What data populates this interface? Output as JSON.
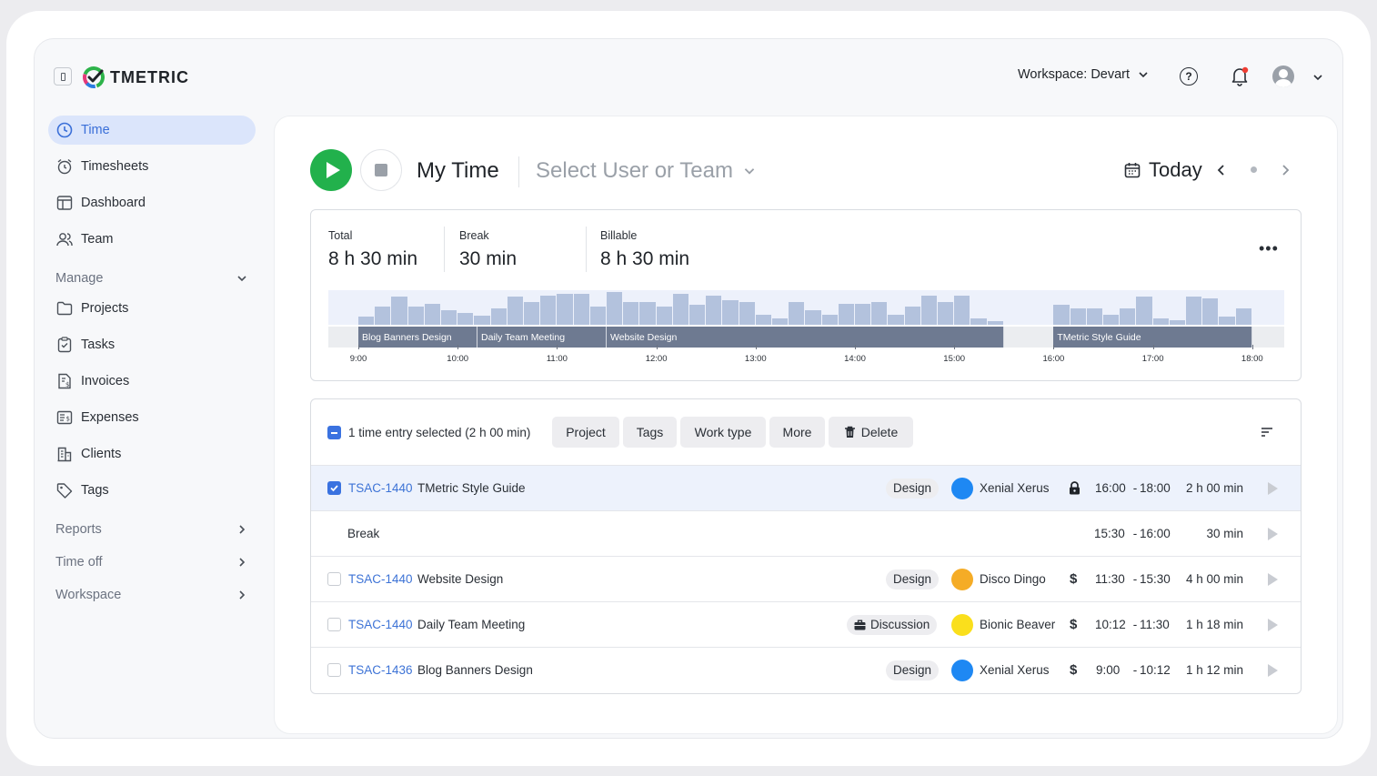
{
  "brand": {
    "name": "TMETRIC"
  },
  "header": {
    "workspace": "Workspace: Devart"
  },
  "sidebar": {
    "items": [
      {
        "label": "Time",
        "icon": "clock-icon",
        "active": true
      },
      {
        "label": "Timesheets",
        "icon": "timesheet-icon"
      },
      {
        "label": "Dashboard",
        "icon": "dashboard-icon"
      },
      {
        "label": "Team",
        "icon": "team-icon"
      }
    ],
    "manage_label": "Manage",
    "manage_items": [
      {
        "label": "Projects",
        "icon": "folder-icon"
      },
      {
        "label": "Tasks",
        "icon": "task-icon"
      },
      {
        "label": "Invoices",
        "icon": "invoice-icon"
      },
      {
        "label": "Expenses",
        "icon": "expenses-icon"
      },
      {
        "label": "Clients",
        "icon": "clients-icon"
      },
      {
        "label": "Tags",
        "icon": "tag-icon"
      }
    ],
    "sections": [
      {
        "label": "Reports"
      },
      {
        "label": "Time off"
      },
      {
        "label": "Workspace"
      }
    ]
  },
  "toolbar": {
    "title": "My Time",
    "user_select": "Select User or Team",
    "date": "Today"
  },
  "summary": {
    "total_label": "Total",
    "total_value": "8 h 30 min",
    "break_label": "Break",
    "break_value": "30 min",
    "billable_label": "Billable",
    "billable_value": "8 h 30 min"
  },
  "timeline": {
    "hours": [
      "9:00",
      "10:00",
      "11:00",
      "12:00",
      "13:00",
      "14:00",
      "15:00",
      "16:00",
      "17:00",
      "18:00"
    ],
    "segments": [
      {
        "label": "Blog Banners Design",
        "start": "9:00",
        "end": "10:12"
      },
      {
        "label": "Daily Team Meeting",
        "start": "10:12",
        "end": "11:30"
      },
      {
        "label": "Website Design",
        "start": "11:30",
        "end": "15:30"
      },
      {
        "label": "TMetric Style Guide",
        "start": "16:00",
        "end": "18:00"
      }
    ]
  },
  "selection": {
    "text": "1 time entry selected (2 h 00 min)",
    "actions": [
      "Project",
      "Tags",
      "Work type",
      "More",
      "Delete"
    ]
  },
  "entries": [
    {
      "selected": true,
      "task_id": "TSAC-1440",
      "title": "TMetric Style Guide",
      "tag": "Design",
      "project": "Xenial Xerus",
      "project_color": "#1e88f3",
      "flag": "lock",
      "start": "16:00",
      "end": "18:00",
      "duration": "2 h 00 min"
    },
    {
      "type": "break",
      "title": "Break",
      "start": "15:30",
      "end": "16:00",
      "duration": "30 min"
    },
    {
      "selected": false,
      "task_id": "TSAC-1440",
      "title": "Website Design",
      "tag": "Design",
      "project": "Disco Dingo",
      "project_color": "#f5ac26",
      "flag": "$",
      "start": "11:30",
      "end": "15:30",
      "duration": "4 h 00 min"
    },
    {
      "selected": false,
      "task_id": "TSAC-1440",
      "title": "Daily Team Meeting",
      "tag": "Discussion",
      "project": "Bionic Beaver",
      "project_color": "#fadf1c",
      "flag": "$",
      "start": "10:12",
      "end": "11:30",
      "duration": "1 h 18 min"
    },
    {
      "selected": false,
      "task_id": "TSAC-1436",
      "title": "Blog Banners Design",
      "tag": "Design",
      "project": "Xenial Xerus",
      "project_color": "#1e88f3",
      "flag": "$",
      "start": "9:00",
      "end": "10:12",
      "duration": "1 h 12 min"
    }
  ]
}
